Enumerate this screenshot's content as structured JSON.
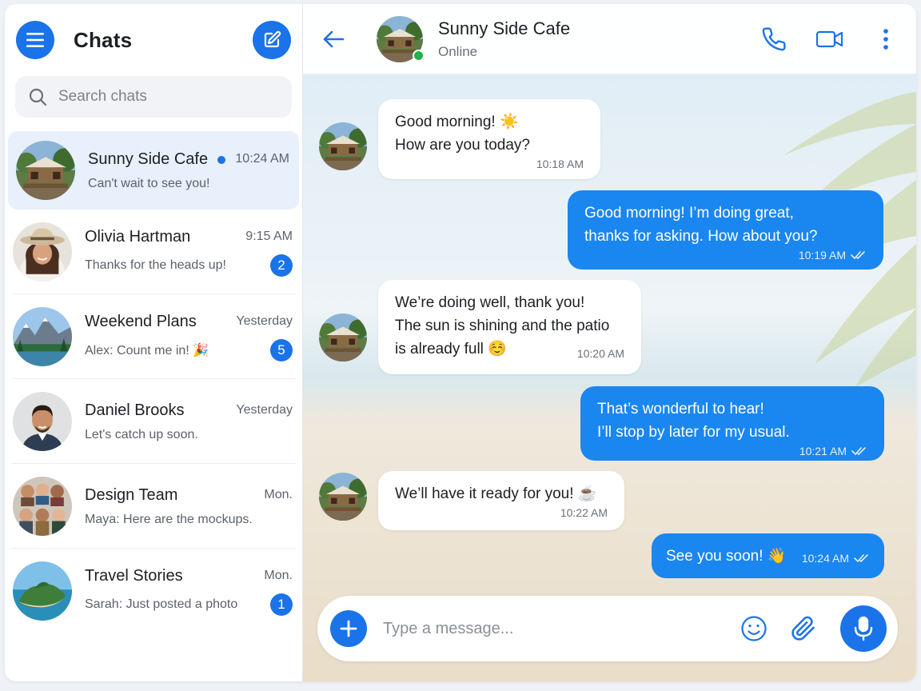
{
  "sidebar": {
    "title": "Chats",
    "search_placeholder": "Search chats",
    "chats": [
      {
        "name": "Sunny Side Cafe",
        "time": "10:24 AM",
        "preview": "Can't wait to see you!",
        "unread": ""
      },
      {
        "name": "Olivia Hartman",
        "time": "9:15 AM",
        "preview": "Thanks for the heads up!",
        "unread": "2"
      },
      {
        "name": "Weekend Plans",
        "time": "Yesterday",
        "preview": "Alex: Count me in! 🎉",
        "unread": "5"
      },
      {
        "name": "Daniel Brooks",
        "time": "Yesterday",
        "preview": "Let's catch up soon.",
        "unread": ""
      },
      {
        "name": "Design Team",
        "time": "Mon.",
        "preview": "Maya: Here are the mockups.",
        "unread": ""
      },
      {
        "name": "Travel Stories",
        "time": "Mon.",
        "preview": "Sarah: Just posted a photo",
        "unread": "1"
      }
    ]
  },
  "conversation": {
    "contact_name": "Sunny Side Cafe",
    "status": "Online",
    "messages": [
      {
        "direction": "in",
        "lines": [
          "Good morning! ☀️",
          "How are you today?"
        ],
        "time": "10:18 AM"
      },
      {
        "direction": "out",
        "lines": [
          "Good morning! I’m doing great,",
          "thanks for asking. How about you?"
        ],
        "time": "10:19 AM"
      },
      {
        "direction": "in",
        "lines": [
          "We’re doing well, thank you!",
          "The sun is shining and the patio",
          "is already full ☺️"
        ],
        "time": "10:20 AM"
      },
      {
        "direction": "out",
        "lines": [
          "That’s wonderful to hear!",
          "I’ll stop by later for my usual."
        ],
        "time": "10:21 AM"
      },
      {
        "direction": "in",
        "lines": [
          "We’ll have it ready for you! ☕"
        ],
        "time": "10:22 AM"
      },
      {
        "direction": "out",
        "lines": [
          "See you soon! 👋"
        ],
        "time": "10:24 AM"
      }
    ]
  },
  "composer": {
    "placeholder": "Type a message..."
  },
  "icons": {
    "menu": "menu-icon",
    "compose": "compose-icon",
    "search": "search-icon",
    "back": "back-arrow-icon",
    "phone": "phone-icon",
    "video": "video-camera-icon",
    "more": "more-vertical-icon",
    "add": "plus-icon",
    "emoji": "emoji-icon",
    "attach": "paperclip-icon",
    "mic": "microphone-icon",
    "read": "double-check-icon"
  },
  "colors": {
    "accent": "#1a73e8",
    "outgoing_bubble": "#1a86f0",
    "online": "#22b14c",
    "active_chat_bg": "#e8f0fb"
  }
}
